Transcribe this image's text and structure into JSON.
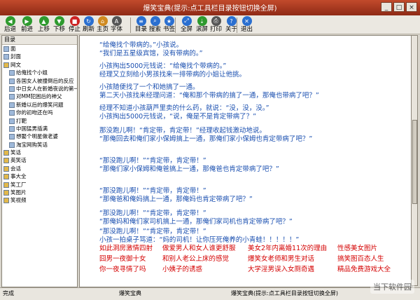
{
  "window": {
    "title": "爆笑宝典(提示:点工具栏目录按钮切换全屏)"
  },
  "toolbar": {
    "buttons": [
      {
        "label": "后退",
        "icon": "back-arrow-icon",
        "color": "#2e9a2e"
      },
      {
        "label": "前进",
        "icon": "forward-arrow-icon",
        "color": "#2e9a2e"
      },
      {
        "label": "上移",
        "icon": "up-arrow-icon",
        "color": "#2e9a2e"
      },
      {
        "label": "下移",
        "icon": "down-arrow-icon",
        "color": "#2e9a2e"
      },
      {
        "label": "停止",
        "icon": "stop-icon",
        "color": "#cc2222"
      },
      {
        "label": "刷新",
        "icon": "refresh-icon",
        "color": "#2a6fd0"
      },
      {
        "label": "主页",
        "icon": "home-icon",
        "color": "#d08a20"
      },
      {
        "label": "字体",
        "icon": "font-icon",
        "color": "#555555"
      },
      {
        "label": "目录",
        "icon": "catalog-icon",
        "color": "#2a6fd0"
      },
      {
        "label": "搜索",
        "icon": "search-icon",
        "color": "#2a6fd0"
      },
      {
        "label": "书签",
        "icon": "bookmark-icon",
        "color": "#2a6fd0"
      },
      {
        "label": "全屏",
        "icon": "fullscreen-icon",
        "color": "#2a6fd0"
      },
      {
        "label": "滚屏",
        "icon": "autoscroll-icon",
        "color": "#2e9a2e"
      },
      {
        "label": "打印",
        "icon": "print-icon",
        "color": "#555555"
      },
      {
        "label": "关于",
        "icon": "about-icon",
        "color": "#2a6fd0"
      },
      {
        "label": "退出",
        "icon": "exit-icon",
        "color": "#2a6fd0"
      }
    ]
  },
  "sidebar": {
    "header": "目录",
    "items": [
      {
        "label": "面",
        "icon": "page-icon"
      },
      {
        "label": "封面",
        "icon": "page-icon"
      },
      {
        "label": "网文",
        "icon": "folder-icon"
      },
      {
        "label": "给俺找个小姐",
        "icon": "page-icon"
      },
      {
        "label": "各国女人被撞倒后的反应",
        "icon": "page-icon"
      },
      {
        "label": "中日女人在新婚夜说的第一句",
        "icon": "page-icon"
      },
      {
        "label": "对MM犯困后的神父",
        "icon": "page-icon"
      },
      {
        "label": "新婚以后的爆笑问题",
        "icon": "page-icon"
      },
      {
        "label": "你的初吻还在吗",
        "icon": "page-icon"
      },
      {
        "label": "打靶",
        "icon": "page-icon"
      },
      {
        "label": "中国猛男插满",
        "icon": "page-icon"
      },
      {
        "label": "想娶个明星做老婆",
        "icon": "page-icon"
      },
      {
        "label": "淘宝网购笑话",
        "icon": "page-icon"
      },
      {
        "label": "笑话",
        "icon": "folder-icon"
      },
      {
        "label": "英笑话",
        "icon": "folder-icon"
      },
      {
        "label": "会话",
        "icon": "folder-icon"
      },
      {
        "label": "事大全",
        "icon": "folder-icon"
      },
      {
        "label": "笑工厂",
        "icon": "folder-icon"
      },
      {
        "label": "笑图片",
        "icon": "folder-icon"
      },
      {
        "label": "笑视频",
        "icon": "folder-icon"
      }
    ]
  },
  "content": {
    "paragraphs": [
      [
        "“给俺找个带病的。”小孩说。",
        "“我们是五星级宾馆，没有带病的。”"
      ],
      [
        "小孩掏出5000元钱说：“给俺找个带病的。”",
        "经理又立刻给小男孩找来一排带病的小姐让他挑。"
      ],
      [
        "小孩随便找了一个和她搞了一通。",
        "第二天小孩找来经理问道：“俺和那个带病的搞了一通，那俺也带病了吧？”"
      ],
      [
        "经理不知道小孩葫芦里卖的什么药，就说：“没，没，没。”",
        "小孩掏出5000元钱说，“说，俺是不是肯定带病了？”"
      ],
      [
        "那没跑儿啊！“肯定带，肯定带！”经理收起钱激动地说。",
        "“那俺回去和俺们家小保姆搞上一通，那俺们家小保姆也肯定带病了吧？”"
      ],
      [
        "“那没跑儿啊！”“肯定带，肯定带！”",
        "“那俺们家小保姆和俺爸搞上一通，那俺爸也肯定带病了吧？”"
      ],
      [
        "“那没跑儿啊！”“肯定带，肯定带！”",
        "“那俺爸和俺妈搞上一通，那俺妈也肯定带病了吧？”"
      ],
      [
        "“那没跑儿啊！”“肯定带，肯定带！”",
        "“那俺妈和俺们家司机搞上一通，那俺们家司机也肯定带病了吧？”"
      ],
      [
        "“那没跑儿啊！”“肯定带，肯定带！”",
        "小孩一拍桌子骂道：“妈的司机！让你压死俺养的小青蛙！！！！！”"
      ]
    ],
    "links": [
      [
        "如此洞房激情四射",
        "做爱男人和女人谁更舒服",
        "美女2年内离婚11次的理由",
        "性感美女图片"
      ],
      [
        "囧男一夜御十女",
        "和别人老公上床的感觉",
        "爆笑女老师和男生对话",
        "搞笑图百态人生"
      ],
      [
        "你一夜寻情了吗",
        "小姨子的诱惑",
        "大学淫男误入女厕奇遇",
        "精品免费游戏大全"
      ]
    ]
  },
  "statusbar": {
    "left": "完成",
    "middle": "爆笑宝典",
    "right": "爆笑宝典(提示:点工具栏目录按钮切换全屏)"
  },
  "watermark": {
    "text": "当下软件园"
  },
  "colors": {
    "titlebar": "#a8361e",
    "content_text": "#1a4fb0",
    "link": "#d40000"
  }
}
